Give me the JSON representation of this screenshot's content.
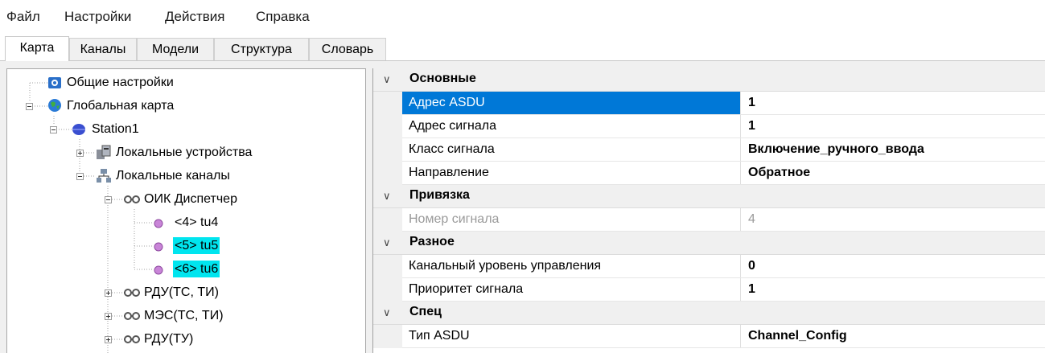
{
  "menu": [
    "Файл",
    "Настройки",
    "Действия",
    "Справка"
  ],
  "tabs": [
    "Карта",
    "Каналы",
    "Модели",
    "Структура",
    "Словарь"
  ],
  "active_tab": "Карта",
  "tree": {
    "nodes": [
      {
        "label": "Общие настройки",
        "icon": "settings-icon"
      },
      {
        "label": "Глобальная карта",
        "icon": "globe-icon",
        "expanded": true
      },
      {
        "label": "Station1",
        "icon": "station-icon",
        "expanded": true
      },
      {
        "label": "Локальные устройства",
        "icon": "devices-icon",
        "expanded": false
      },
      {
        "label": "Локальные каналы",
        "icon": "network-icon",
        "expanded": true
      },
      {
        "label": "ОИК Диспетчер",
        "icon": "channel-icon",
        "expanded": true
      },
      {
        "label": "<4> tu4",
        "icon": "signal-icon",
        "highlight": false
      },
      {
        "label": "<5> tu5",
        "icon": "signal-icon",
        "highlight": true
      },
      {
        "label": "<6> tu6",
        "icon": "signal-icon",
        "highlight": true
      },
      {
        "label": "РДУ(ТС, ТИ)",
        "icon": "channel-icon",
        "expanded": false
      },
      {
        "label": "МЭС(ТС, ТИ)",
        "icon": "channel-icon",
        "expanded": false
      },
      {
        "label": "РДУ(ТУ)",
        "icon": "channel-icon",
        "expanded": false
      }
    ]
  },
  "properties": {
    "categories": [
      {
        "name": "Основные",
        "rows": [
          {
            "name": "Адрес ASDU",
            "value": "1",
            "selected": true
          },
          {
            "name": "Адрес сигнала",
            "value": "1"
          },
          {
            "name": "Класс сигнала",
            "value": "Включение_ручного_ввода"
          },
          {
            "name": "Направление",
            "value": "Обратное"
          }
        ]
      },
      {
        "name": "Привязка",
        "rows": [
          {
            "name": "Номер сигнала",
            "value": "4",
            "disabled": true
          }
        ]
      },
      {
        "name": "Разное",
        "rows": [
          {
            "name": "Канальный уровень управления",
            "value": "0"
          },
          {
            "name": "Приоритет сигнала",
            "value": "1"
          }
        ]
      },
      {
        "name": "Спец",
        "rows": [
          {
            "name": "Тип ASDU",
            "value": "Channel_Config"
          }
        ]
      }
    ]
  },
  "colors": {
    "selection": "#0078d7",
    "highlight": "#00e5ef",
    "panel": "#f0f0f0"
  }
}
